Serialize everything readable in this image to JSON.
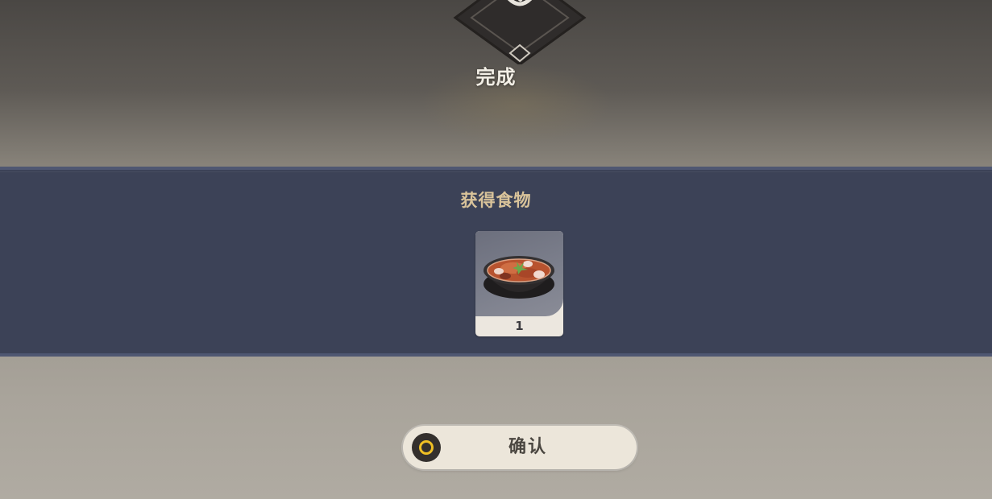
{
  "header": {
    "emblem_icon": "cooking-pot-icon",
    "title": "完成"
  },
  "reward": {
    "title": "获得食物",
    "items": [
      {
        "icon": "stew-bowl-icon",
        "count": "1"
      }
    ]
  },
  "actions": {
    "confirm_label": "确认",
    "confirm_icon": "gamepad-circle-button-icon"
  },
  "colors": {
    "band": "#3c4257",
    "reward_title": "#d9c39a",
    "button_bg": "#ece6da",
    "button_icon_ring": "#f0c024"
  }
}
